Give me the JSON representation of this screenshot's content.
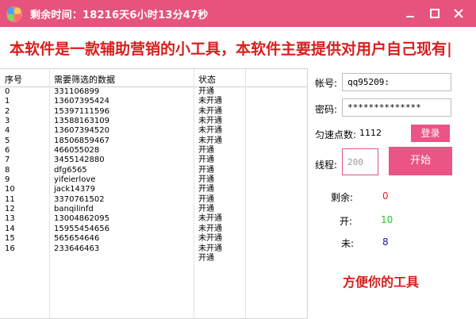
{
  "window": {
    "title": "剩余时间：18216天6小时13分47秒",
    "minimize_glyph": "—",
    "maximize_glyph": "□",
    "close_glyph": "✕"
  },
  "banner": {
    "text": "本软件是一款辅助营销的小工具，本软件主要提供对用户自己现有|"
  },
  "table": {
    "headers": [
      "序号",
      "需要筛选的数据",
      "状态"
    ],
    "rows": [
      {
        "idx": "0",
        "data": "331106899",
        "state": "开通"
      },
      {
        "idx": "1",
        "data": "13607395424",
        "state": "未开通"
      },
      {
        "idx": "2",
        "data": "15397111596",
        "state": "未开通"
      },
      {
        "idx": "3",
        "data": "13588163109",
        "state": "未开通"
      },
      {
        "idx": "4",
        "data": "13607394520",
        "state": "未开通"
      },
      {
        "idx": "5",
        "data": "18506859467",
        "state": "未开通"
      },
      {
        "idx": "6",
        "data": "466055028",
        "state": "开通"
      },
      {
        "idx": "7",
        "data": "3455142880",
        "state": "开通"
      },
      {
        "idx": "8",
        "data": "dfg6565",
        "state": "开通"
      },
      {
        "idx": "9",
        "data": "yifeierlove",
        "state": "开通"
      },
      {
        "idx": "10",
        "data": "jack14379",
        "state": "开通"
      },
      {
        "idx": "11",
        "data": "3370761502",
        "state": "开通"
      },
      {
        "idx": "12",
        "data": "banqilinfd",
        "state": "开通"
      },
      {
        "idx": "13",
        "data": "13004862095",
        "state": "未开通"
      },
      {
        "idx": "14",
        "data": "15955454656",
        "state": "未开通"
      },
      {
        "idx": "15",
        "data": "565654646",
        "state": "未开通"
      },
      {
        "idx": "16",
        "data": "233646463",
        "state": "未开通"
      },
      {
        "idx": "",
        "data": "",
        "state": "开通"
      }
    ]
  },
  "account": {
    "label": "帐号:",
    "value": "qq95209:"
  },
  "password": {
    "label": "密码:",
    "value": "**************"
  },
  "points": {
    "label": "匀速点数:",
    "value": "1112"
  },
  "login_button": "登录",
  "threads": {
    "label": "线程:",
    "placeholder": "200"
  },
  "start_button": "开始",
  "stats": {
    "remaining_label": "剩余:",
    "remaining_value": "0",
    "open_label": "开:",
    "open_value": "10",
    "closed_label": "未:",
    "closed_value": "8"
  },
  "slogan": "方便你的工具",
  "colors": {
    "accent": "#e6537c",
    "button": "#ea5585",
    "banner_text": "#d81e1e",
    "remaining_value": "#e02020",
    "open_value": "#22cc22",
    "closed_value": "#1a1aa0"
  }
}
